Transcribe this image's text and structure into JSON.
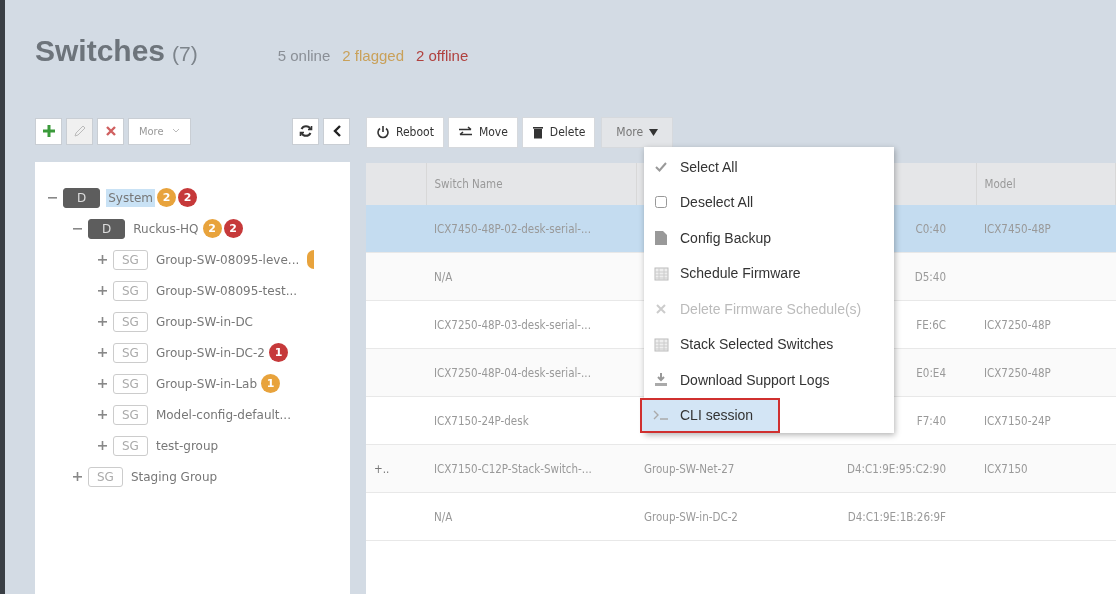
{
  "header": {
    "title": "Switches",
    "count": "(7)",
    "statuses": [
      {
        "text": "5 online",
        "color": "#8a8f96"
      },
      {
        "text": "2 flagged",
        "color": "#c9a15a"
      },
      {
        "text": "2 offline",
        "color": "#b0413e"
      }
    ]
  },
  "tree_toolbar": {
    "buttons": [
      {
        "kind": "add",
        "disabled": false
      },
      {
        "kind": "edit",
        "disabled": true
      },
      {
        "kind": "delete",
        "disabled": false
      }
    ],
    "more": "More"
  },
  "tree": [
    {
      "tag": "D",
      "label": "System",
      "selected": true,
      "expanded": true,
      "badges": [
        {
          "text": "2",
          "color": "#e8a33c"
        },
        {
          "text": "2",
          "color": "#c6393a"
        }
      ],
      "children": [
        {
          "tag": "D",
          "label": "Ruckus-HQ",
          "selected": false,
          "expanded": true,
          "badges": [
            {
              "text": "2",
              "color": "#e8a33c"
            },
            {
              "text": "2",
              "color": "#c6393a"
            }
          ],
          "children": [
            {
              "tag": "SG",
              "label": "Group-SW-08095-leve...",
              "selected": false,
              "expanded": false,
              "badges": [
                {
                  "color": "#e8a33c"
                }
              ]
            },
            {
              "tag": "SG",
              "label": "Group-SW-08095-test...",
              "selected": false,
              "expanded": false
            },
            {
              "tag": "SG",
              "label": "Group-SW-in-DC",
              "selected": false,
              "expanded": false
            },
            {
              "tag": "SG",
              "label": "Group-SW-in-DC-2",
              "selected": false,
              "expanded": false,
              "badges": [
                {
                  "text": "1",
                  "color": "#c6393a"
                }
              ]
            },
            {
              "tag": "SG",
              "label": "Group-SW-in-Lab",
              "selected": false,
              "expanded": false,
              "badges": [
                {
                  "text": "1",
                  "color": "#e8a33c"
                }
              ]
            },
            {
              "tag": "SG",
              "label": "Model-config-default...",
              "selected": false,
              "expanded": false
            },
            {
              "tag": "SG",
              "label": "test-group",
              "selected": false,
              "expanded": false
            }
          ]
        },
        {
          "tag": "SG",
          "label": "Staging Group",
          "selected": false,
          "expanded": false
        }
      ]
    }
  ],
  "actions": [
    {
      "kind": "power",
      "label": "Reboot"
    },
    {
      "kind": "move",
      "label": "Move"
    },
    {
      "kind": "trash",
      "label": "Delete"
    }
  ],
  "more_button": {
    "label": "More",
    "expanded": true
  },
  "table": {
    "columns": [
      "Switch Name",
      "Model"
    ],
    "rows": [
      {
        "selected": true,
        "name": "ICX7450-48P-02-desk-serial-...",
        "mac": "C0:40",
        "model": "ICX7450-48P"
      },
      {
        "selected": false,
        "name": "N/A",
        "mac": "D5:40"
      },
      {
        "selected": false,
        "name": "ICX7250-48P-03-desk-serial-...",
        "mac": "FE:6C",
        "model": "ICX7250-48P"
      },
      {
        "selected": false,
        "name": "ICX7250-48P-04-desk-serial-...",
        "mac": "E0:E4",
        "model": "ICX7250-48P"
      },
      {
        "selected": false,
        "name": "ICX7150-24P-desk",
        "mac": "F7:40",
        "model": "ICX7150-24P"
      },
      {
        "selected": false,
        "expander": "+..",
        "name": "ICX7150-C12P-Stack-Switch-...",
        "group": "Group-SW-Net-27",
        "mac": "D4:C1:9E:95:C2:90",
        "model": "ICX7150"
      },
      {
        "selected": false,
        "name": "N/A",
        "group": "Group-SW-in-DC-2",
        "mac": "D4:C1:9E:1B:26:9F"
      }
    ]
  },
  "menu": [
    {
      "kind": "check",
      "label": "Select All",
      "disabled": false,
      "selected": false
    },
    {
      "kind": "box",
      "label": "Deselect All",
      "disabled": false,
      "selected": false
    },
    {
      "kind": "file",
      "label": "Config Backup",
      "disabled": false,
      "selected": false
    },
    {
      "kind": "calendar",
      "label": "Schedule Firmware",
      "disabled": false,
      "selected": false
    },
    {
      "kind": "x",
      "label": "Delete Firmware Schedule(s)",
      "disabled": true,
      "selected": false
    },
    {
      "kind": "calendar",
      "label": "Stack Selected Switches",
      "disabled": false,
      "selected": false
    },
    {
      "kind": "download",
      "label": "Download Support Logs",
      "disabled": false,
      "selected": false
    },
    {
      "kind": "terminal",
      "label": "CLI session",
      "disabled": false,
      "selected": true
    }
  ]
}
